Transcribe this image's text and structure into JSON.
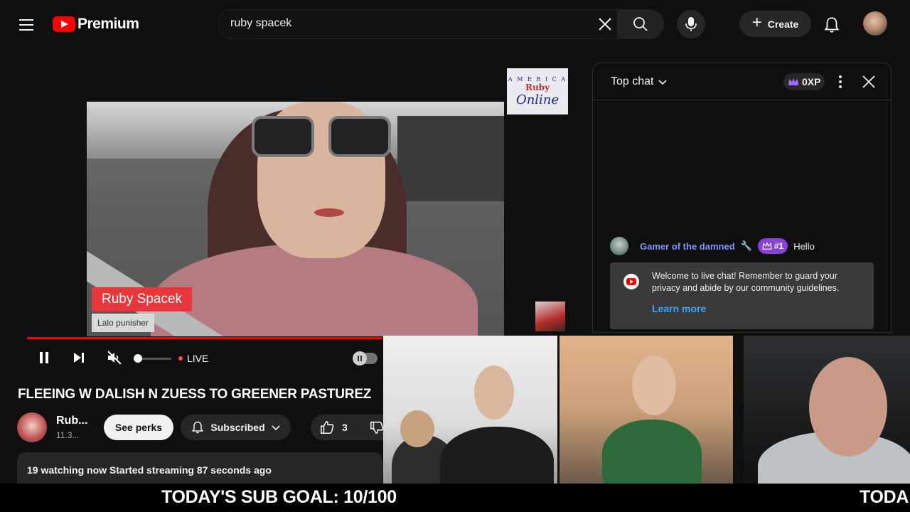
{
  "header": {
    "logo_text": "Premium",
    "search_value": "ruby spacek",
    "create_label": "Create"
  },
  "video": {
    "lower_third_name": "Ruby Spacek",
    "lower_third_sub": "Lalo punisher",
    "channel_logo_small": "A M E R I C A",
    "channel_logo_text": "Ruby",
    "channel_logo_script": "Online",
    "live_label": "LIVE",
    "title": "FLEEING W DALISH N ZUESS TO GREENER PASTUREZ"
  },
  "owner": {
    "name": "Rub...",
    "subs": "11.3...",
    "perks_label": "See perks",
    "subscribed_label": "Subscribed",
    "likes": "3"
  },
  "description": {
    "stats": "19 watching now  Started streaming 87 seconds ago"
  },
  "chat": {
    "mode_label": "Top chat",
    "xp_label": "0XP",
    "message": {
      "author": "Gamer of the damned",
      "rank": "#1",
      "text": "Hello"
    },
    "welcome_text": "Welcome to live chat! Remember to guard your privacy and abide by our community guidelines.",
    "learn_more": "Learn more"
  },
  "ticker": {
    "text": "TODAY'S SUB GOAL: 10/100",
    "repeat": "TODA"
  },
  "colors": {
    "brand_red": "#ff0000",
    "link_blue": "#3ea6ff",
    "author_blue": "#7c94ff",
    "rank_purple": "#8a42d6",
    "lower_third_red": "#e8363d"
  }
}
